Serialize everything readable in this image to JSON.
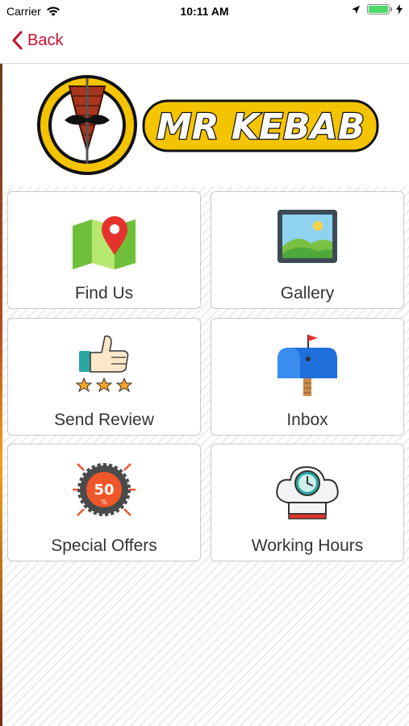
{
  "status": {
    "carrier": "Carrier",
    "time": "10:11 AM"
  },
  "nav": {
    "back_label": "Back"
  },
  "brand": {
    "name": "MR KEBAB"
  },
  "menu": [
    {
      "label": "Find Us",
      "icon": "map-pin-icon"
    },
    {
      "label": "Gallery",
      "icon": "picture-frame-icon"
    },
    {
      "label": "Send Review",
      "icon": "thumbs-up-stars-icon"
    },
    {
      "label": "Inbox",
      "icon": "mailbox-icon"
    },
    {
      "label": "Special Offers",
      "icon": "discount-50-icon"
    },
    {
      "label": "Working Hours",
      "icon": "chef-hat-clock-icon"
    }
  ],
  "colors": {
    "accent": "#c8102e",
    "logo_yellow": "#f5c400",
    "battery": "#4cd964"
  }
}
